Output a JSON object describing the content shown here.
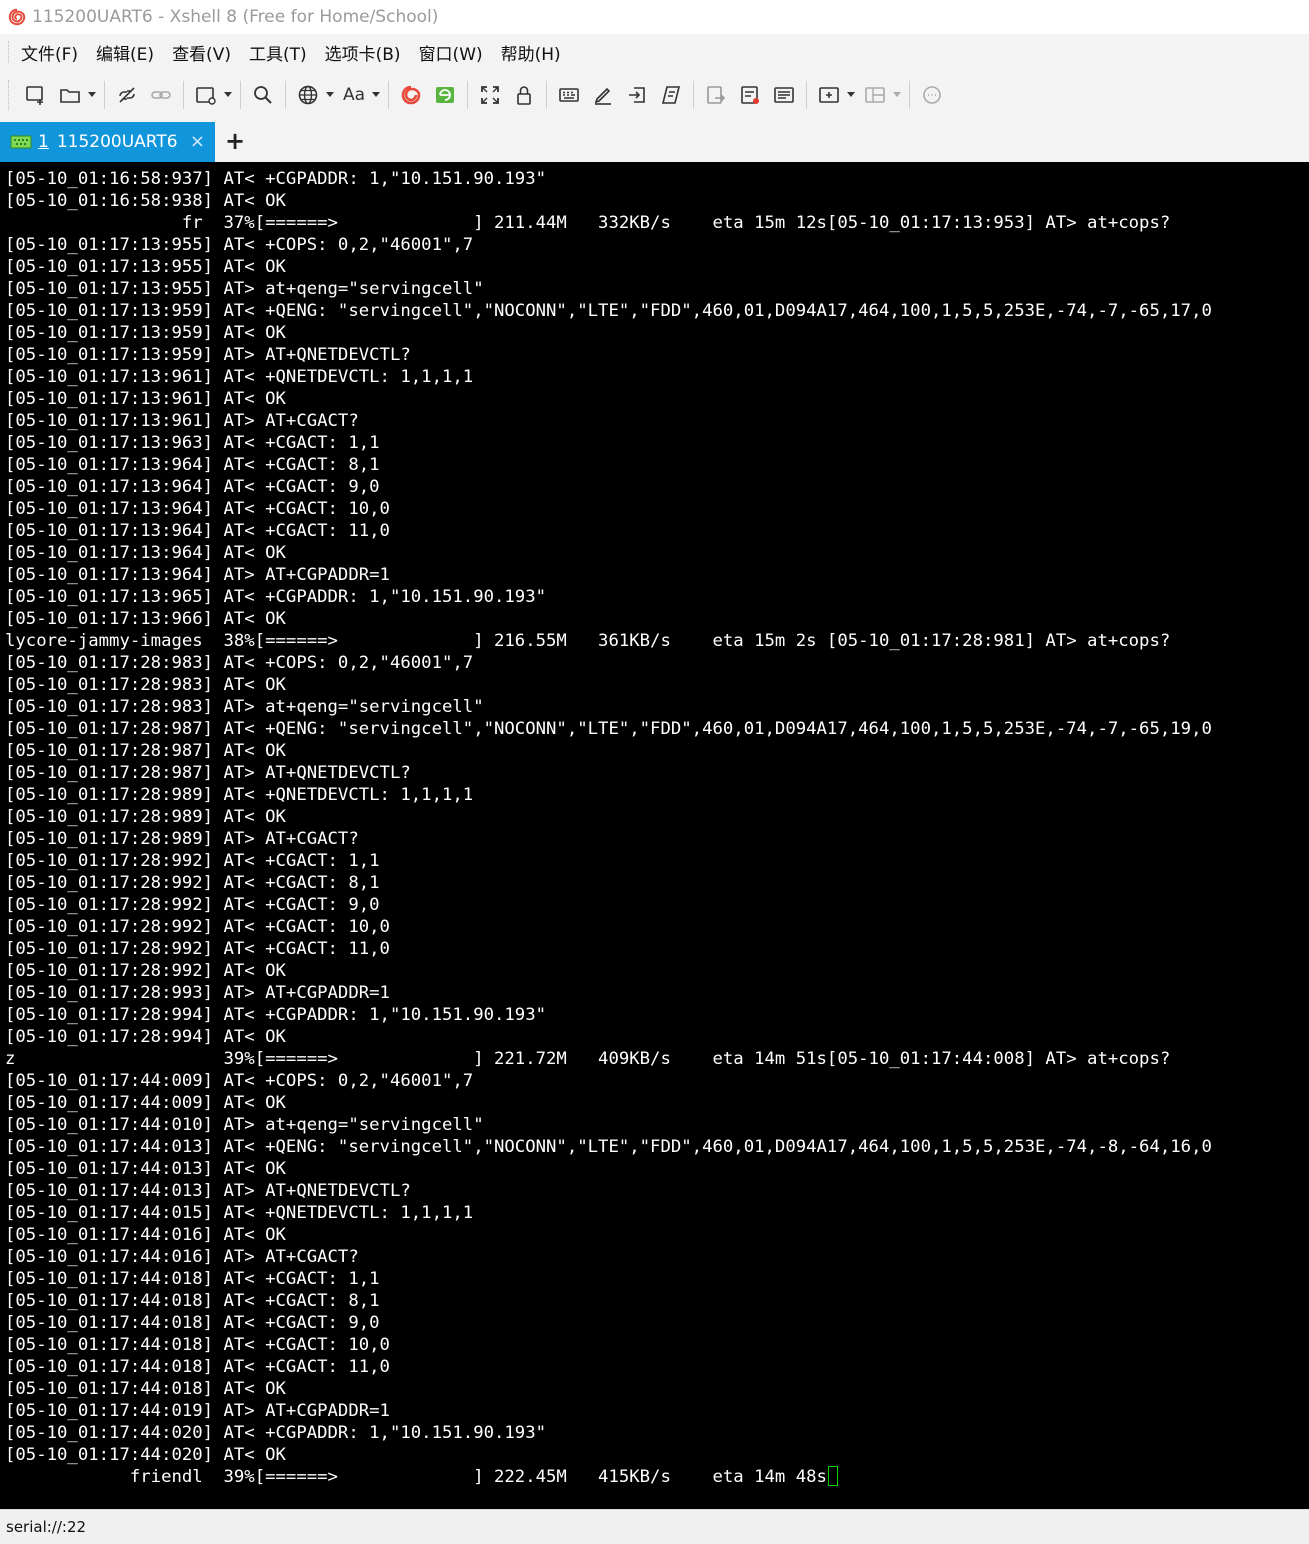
{
  "window": {
    "title": "115200UART6 - Xshell 8 (Free for Home/School)"
  },
  "menubar": {
    "items": [
      "文件(F)",
      "编辑(E)",
      "查看(V)",
      "工具(T)",
      "选项卡(B)",
      "窗口(W)",
      "帮助(H)"
    ]
  },
  "toolbar": {
    "font_label": "Aa"
  },
  "tabs": {
    "active": {
      "number": "1",
      "label": "115200UART6",
      "close": "×"
    },
    "add": "+"
  },
  "terminal": {
    "lines": [
      "[05-10_01:16:58:937] AT< +CGPADDR: 1,\"10.151.90.193\"",
      "[05-10_01:16:58:938] AT< OK",
      "                 fr  37%[======>             ] 211.44M   332KB/s    eta 15m 12s[05-10_01:17:13:953] AT> at+cops?",
      "[05-10_01:17:13:955] AT< +COPS: 0,2,\"46001\",7",
      "[05-10_01:17:13:955] AT< OK",
      "[05-10_01:17:13:955] AT> at+qeng=\"servingcell\"",
      "[05-10_01:17:13:959] AT< +QENG: \"servingcell\",\"NOCONN\",\"LTE\",\"FDD\",460,01,D094A17,464,100,1,5,5,253E,-74,-7,-65,17,0",
      "[05-10_01:17:13:959] AT< OK",
      "[05-10_01:17:13:959] AT> AT+QNETDEVCTL?",
      "[05-10_01:17:13:961] AT< +QNETDEVCTL: 1,1,1,1",
      "[05-10_01:17:13:961] AT< OK",
      "[05-10_01:17:13:961] AT> AT+CGACT?",
      "[05-10_01:17:13:963] AT< +CGACT: 1,1",
      "[05-10_01:17:13:964] AT< +CGACT: 8,1",
      "[05-10_01:17:13:964] AT< +CGACT: 9,0",
      "[05-10_01:17:13:964] AT< +CGACT: 10,0",
      "[05-10_01:17:13:964] AT< +CGACT: 11,0",
      "[05-10_01:17:13:964] AT< OK",
      "[05-10_01:17:13:964] AT> AT+CGPADDR=1",
      "[05-10_01:17:13:965] AT< +CGPADDR: 1,\"10.151.90.193\"",
      "[05-10_01:17:13:966] AT< OK",
      "lycore-jammy-images  38%[======>             ] 216.55M   361KB/s    eta 15m 2s [05-10_01:17:28:981] AT> at+cops?",
      "[05-10_01:17:28:983] AT< +COPS: 0,2,\"46001\",7",
      "[05-10_01:17:28:983] AT< OK",
      "[05-10_01:17:28:983] AT> at+qeng=\"servingcell\"",
      "[05-10_01:17:28:987] AT< +QENG: \"servingcell\",\"NOCONN\",\"LTE\",\"FDD\",460,01,D094A17,464,100,1,5,5,253E,-74,-7,-65,19,0",
      "[05-10_01:17:28:987] AT< OK",
      "[05-10_01:17:28:987] AT> AT+QNETDEVCTL?",
      "[05-10_01:17:28:989] AT< +QNETDEVCTL: 1,1,1,1",
      "[05-10_01:17:28:989] AT< OK",
      "[05-10_01:17:28:989] AT> AT+CGACT?",
      "[05-10_01:17:28:992] AT< +CGACT: 1,1",
      "[05-10_01:17:28:992] AT< +CGACT: 8,1",
      "[05-10_01:17:28:992] AT< +CGACT: 9,0",
      "[05-10_01:17:28:992] AT< +CGACT: 10,0",
      "[05-10_01:17:28:992] AT< +CGACT: 11,0",
      "[05-10_01:17:28:992] AT< OK",
      "[05-10_01:17:28:993] AT> AT+CGPADDR=1",
      "[05-10_01:17:28:994] AT< +CGPADDR: 1,\"10.151.90.193\"",
      "[05-10_01:17:28:994] AT< OK",
      "z                    39%[======>             ] 221.72M   409KB/s    eta 14m 51s[05-10_01:17:44:008] AT> at+cops?",
      "[05-10_01:17:44:009] AT< +COPS: 0,2,\"46001\",7",
      "[05-10_01:17:44:009] AT< OK",
      "[05-10_01:17:44:010] AT> at+qeng=\"servingcell\"",
      "[05-10_01:17:44:013] AT< +QENG: \"servingcell\",\"NOCONN\",\"LTE\",\"FDD\",460,01,D094A17,464,100,1,5,5,253E,-74,-8,-64,16,0",
      "[05-10_01:17:44:013] AT< OK",
      "[05-10_01:17:44:013] AT> AT+QNETDEVCTL?",
      "[05-10_01:17:44:015] AT< +QNETDEVCTL: 1,1,1,1",
      "[05-10_01:17:44:016] AT< OK",
      "[05-10_01:17:44:016] AT> AT+CGACT?",
      "[05-10_01:17:44:018] AT< +CGACT: 1,1",
      "[05-10_01:17:44:018] AT< +CGACT: 8,1",
      "[05-10_01:17:44:018] AT< +CGACT: 9,0",
      "[05-10_01:17:44:018] AT< +CGACT: 10,0",
      "[05-10_01:17:44:018] AT< +CGACT: 11,0",
      "[05-10_01:17:44:018] AT< OK",
      "[05-10_01:17:44:019] AT> AT+CGPADDR=1",
      "[05-10_01:17:44:020] AT< +CGPADDR: 1,\"10.151.90.193\"",
      "[05-10_01:17:44:020] AT< OK",
      "            friendl  39%[======>             ] 222.45M   415KB/s    eta 14m 48s"
    ]
  },
  "statusbar": {
    "connection": "serial://:22"
  },
  "colors": {
    "terminal_bg": "#000000",
    "terminal_fg": "#ffffff",
    "tab_active": "#1296db",
    "cursor": "#00d000"
  }
}
